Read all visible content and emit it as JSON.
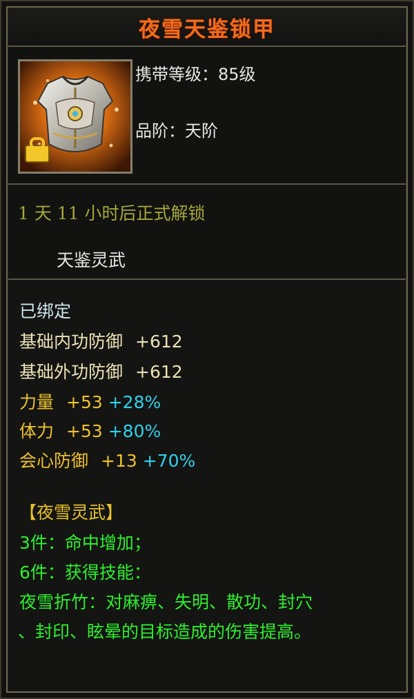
{
  "item": {
    "name": "夜雪天鉴锁甲",
    "level_label": "携带等级：",
    "level_value": "85级",
    "grade_label": "品阶：",
    "grade_value": "天阶",
    "unlock_text": "1 天 11 小时后正式解锁",
    "series": "天鉴灵武"
  },
  "stats": {
    "bound": "已绑定",
    "base_lines": [
      {
        "label": "基础内功防御",
        "value": "+612"
      },
      {
        "label": "基础外功防御",
        "value": "+612"
      }
    ],
    "bonus_lines": [
      {
        "label": "力量",
        "value": "+53",
        "pct": "+28%"
      },
      {
        "label": "体力",
        "value": "+53",
        "pct": "+80%"
      },
      {
        "label": "会心防御",
        "value": "+13",
        "pct": "+70%"
      }
    ]
  },
  "set": {
    "title": "【夜雪灵武】",
    "bonus_3": "3件：命中增加；",
    "bonus_6": "6件：获得技能：",
    "skill_line1": "夜雪折竹：对麻痹、失明、散功、封穴",
    "skill_line2": "、封印、眩晕的目标造成的伤害提高。"
  },
  "colors": {
    "title": "#f26c1c",
    "unlock": "#a4a73c",
    "bonus_base": "#eec22c",
    "bonus_pct": "#2fd2ea",
    "set_effect": "#2df02d",
    "set_title": "#e6c12a"
  },
  "icons": {
    "item": "armor-chestplate-icon",
    "bind": "bound-lock-icon"
  }
}
